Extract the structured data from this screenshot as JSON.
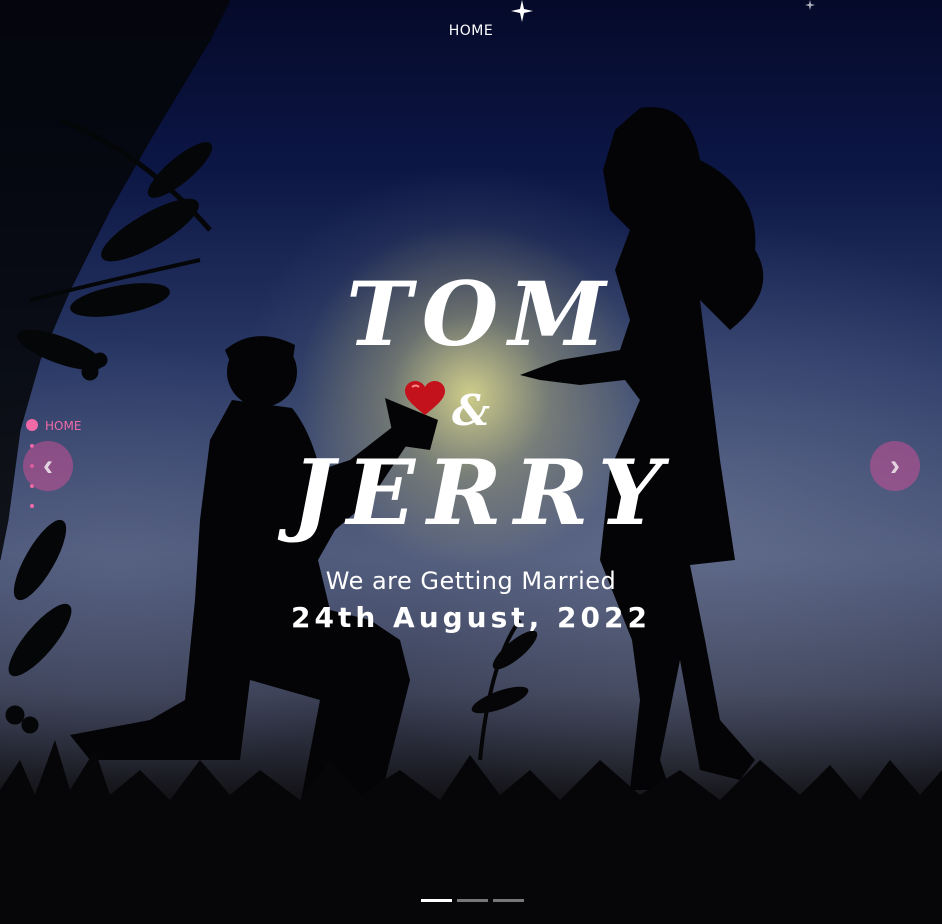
{
  "nav": {
    "home_label": "HOME"
  },
  "hero": {
    "name_one": "TOM",
    "ampersand": "&",
    "name_two": "JERRY",
    "tagline": "We are Getting Married",
    "date": "24th August, 2022"
  },
  "side_nav": {
    "active_label": "HOME"
  },
  "carousel": {
    "prev_icon": "chevron-left-icon",
    "next_icon": "chevron-right-icon",
    "prev_glyph": "‹",
    "next_glyph": "›",
    "slide_count": 3,
    "active_slide": 1
  },
  "colors": {
    "accent": "#f06aa8",
    "heart": "#c4121c",
    "text": "#ffffff"
  }
}
